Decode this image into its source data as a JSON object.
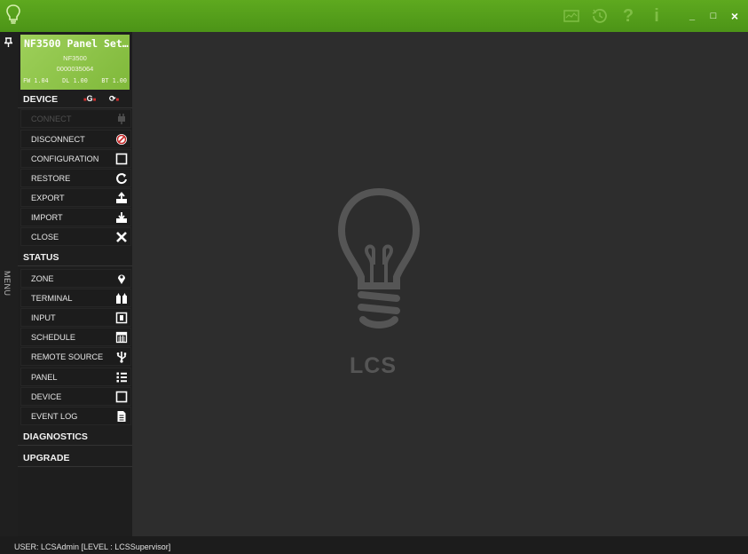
{
  "titlebar": {
    "icons": [
      "lightbulb-icon",
      "monitor-icon",
      "history-icon",
      "help-icon",
      "info-icon"
    ],
    "window_controls": {
      "minimize": "_",
      "maximize": "□",
      "close": "×"
    },
    "accent_color": "#4c9417"
  },
  "sidebar": {
    "pin_icon": "pin-icon",
    "menu_label": "MENU",
    "device_card": {
      "name": "NF3500 Panel Set…",
      "model": "NF3500",
      "serial": "0000035064",
      "fw": "FW 1.04",
      "dl": "DL 1.00",
      "bt": "BT 1.00"
    },
    "sections": {
      "device": {
        "label": "DEVICE",
        "indicator_g": "G",
        "items": [
          {
            "label": "CONNECT",
            "icon": "plug-icon",
            "disabled": true
          },
          {
            "label": "DISCONNECT",
            "icon": "no-plug-icon"
          },
          {
            "label": "CONFIGURATION",
            "icon": "square-icon"
          },
          {
            "label": "RESTORE",
            "icon": "restore-icon"
          },
          {
            "label": "EXPORT",
            "icon": "export-icon"
          },
          {
            "label": "IMPORT",
            "icon": "import-icon"
          },
          {
            "label": "CLOSE",
            "icon": "close-icon"
          }
        ]
      },
      "status": {
        "label": "STATUS",
        "items": [
          {
            "label": "ZONE",
            "icon": "location-pin-icon"
          },
          {
            "label": "TERMINAL",
            "icon": "terminal-icon"
          },
          {
            "label": "INPUT",
            "icon": "input-icon"
          },
          {
            "label": "SCHEDULE",
            "icon": "calendar-icon"
          },
          {
            "label": "REMOTE SOURCE",
            "icon": "usb-icon"
          },
          {
            "label": "PANEL",
            "icon": "list-icon"
          },
          {
            "label": "DEVICE",
            "icon": "square-icon"
          },
          {
            "label": "EVENT LOG",
            "icon": "document-icon"
          }
        ]
      },
      "diagnostics": {
        "label": "DIAGNOSTICS"
      },
      "upgrade": {
        "label": "UPGRADE"
      }
    }
  },
  "main": {
    "watermark": "LCS",
    "watermark_icon": "lightbulb-icon"
  },
  "statusbar": {
    "text": "USER: LCSAdmin [LEVEL : LCSSupervisor]"
  }
}
